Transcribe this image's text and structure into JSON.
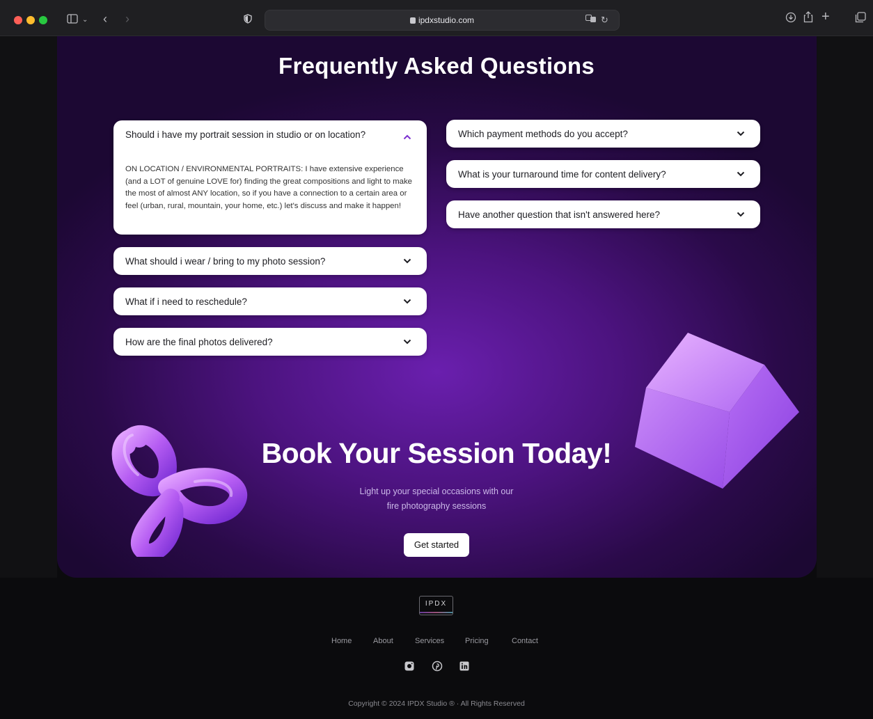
{
  "browser": {
    "url": "ipdxstudio.com"
  },
  "faq": {
    "title": "Frequently Asked Questions",
    "left": [
      {
        "question": "Should i have my portrait session in studio or on location?",
        "expanded": true,
        "answer": "ON LOCATION / ENVIRONMENTAL PORTRAITS: I have extensive experience (and a LOT of genuine LOVE for) finding the great compositions and light to make the most of almost ANY location, so if you have a connection to a certain area or feel (urban, rural, mountain, your home, etc.) let's discuss and make it happen!"
      },
      {
        "question": "What should i wear / bring to my photo session?",
        "expanded": false
      },
      {
        "question": "What if i need to reschedule?",
        "expanded": false
      },
      {
        "question": "How are the final photos delivered?",
        "expanded": false
      }
    ],
    "right": [
      {
        "question": "Which payment methods do you accept?",
        "expanded": false
      },
      {
        "question": "What is your turnaround time for content delivery?",
        "expanded": false
      },
      {
        "question": "Have another question that isn't answered here?",
        "expanded": false
      }
    ]
  },
  "cta": {
    "title": "Book Your Session Today!",
    "subtitle_line1": "Light up your special occasions with our",
    "subtitle_line2": "fire photography sessions",
    "button": "Get started"
  },
  "footer": {
    "logo": "IPDX",
    "nav": [
      "Home",
      "About",
      "Services",
      "Pricing",
      "Contact"
    ],
    "social": [
      "instagram-icon",
      "pinterest-icon",
      "linkedin-icon"
    ],
    "copyright": "Copyright © 2024 IPDX Studio ® · All Rights Reserved"
  },
  "colors": {
    "accent": "#6a1fae",
    "chevron_open": "#7b2fd0"
  }
}
